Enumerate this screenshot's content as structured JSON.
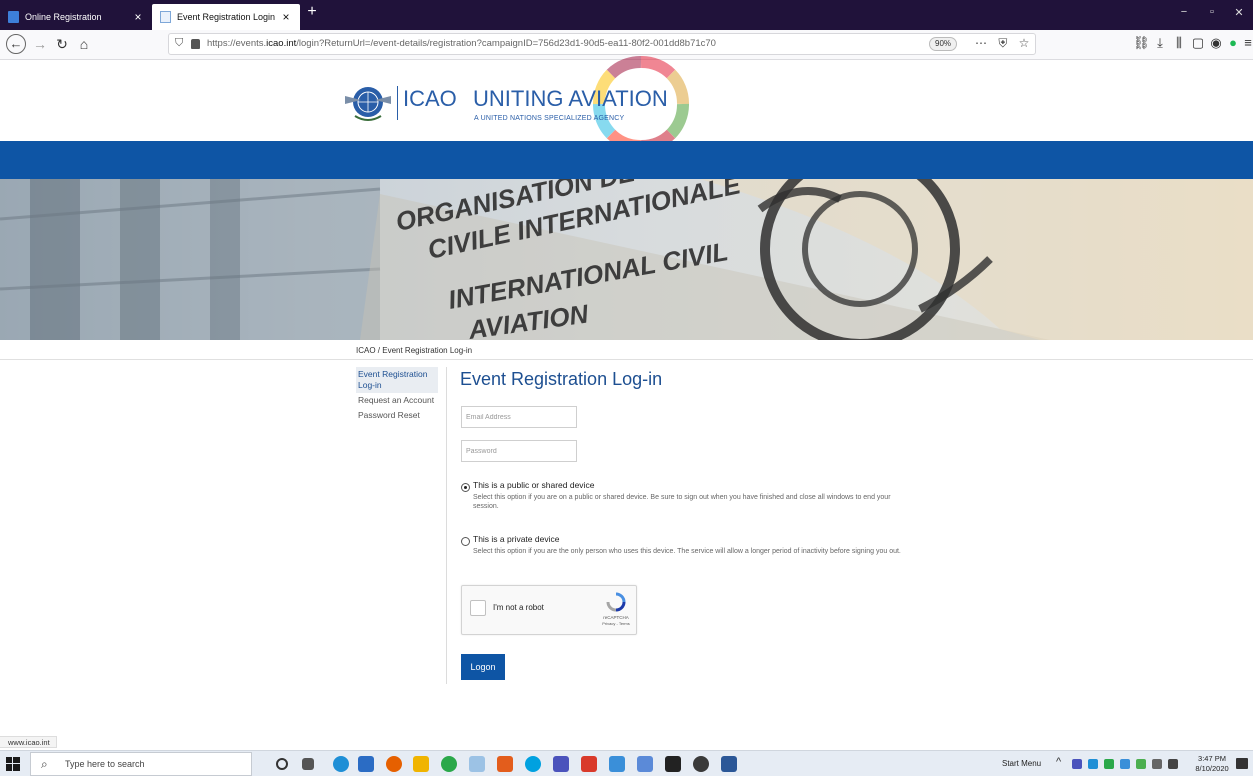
{
  "browser": {
    "tabs": [
      {
        "title": "Online Registration",
        "active": false
      },
      {
        "title": "Event Registration Login",
        "active": true
      }
    ],
    "url_prefix": "https://events.",
    "url_domain": "icao.int",
    "url_suffix": "/login?ReturnUrl=/event-details/registration?campaignID=756d23d1-90d5-ea11-80f2-001dd8b71c70",
    "zoom": "90%",
    "status_url": "www.icao.int"
  },
  "header": {
    "org_short": "ICAO",
    "tagline": "UNITING AVIATION",
    "subtitle": "A UNITED NATIONS SPECIALIZED AGENCY"
  },
  "banner": {
    "line1": "ORGANISATION DE",
    "line2": "CIVILE INTERNATIONALE",
    "line3": "INTERNATIONAL CIVIL",
    "line4": "AVIATION"
  },
  "breadcrumb": {
    "home": "ICAO",
    "separator": " / ",
    "current": "Event Registration Log-in"
  },
  "sidenav": {
    "items": [
      {
        "label": "Event Registration Log-in",
        "active": true
      },
      {
        "label": "Request an Account",
        "active": false
      },
      {
        "label": "Password Reset",
        "active": false
      }
    ]
  },
  "form": {
    "heading": "Event Registration Log-in",
    "email_placeholder": "Email Address",
    "password_placeholder": "Password",
    "option_public_label": "This is a public or shared device",
    "option_public_desc": "Select this option if you are on a public or shared device. Be sure to sign out when you have finished and close all windows to end your session.",
    "option_private_label": "This is a private device",
    "option_private_desc": "Select this option if you are the only person who uses this device. The service will allow a longer period of inactivity before signing you out.",
    "selected_option": "public",
    "captcha_label": "I'm not a robot",
    "captcha_brand": "reCAPTCHA",
    "captcha_terms": "Privacy - Terms",
    "submit_label": "Logon"
  },
  "taskbar": {
    "search_placeholder": "Type here to search",
    "start_menu_label": "Start Menu",
    "time": "3:47 PM",
    "date": "8/10/2020"
  },
  "colors": {
    "brand_blue": "#0e55a5",
    "heading_blue": "#1d4f91",
    "tab_bar": "#20123a"
  }
}
